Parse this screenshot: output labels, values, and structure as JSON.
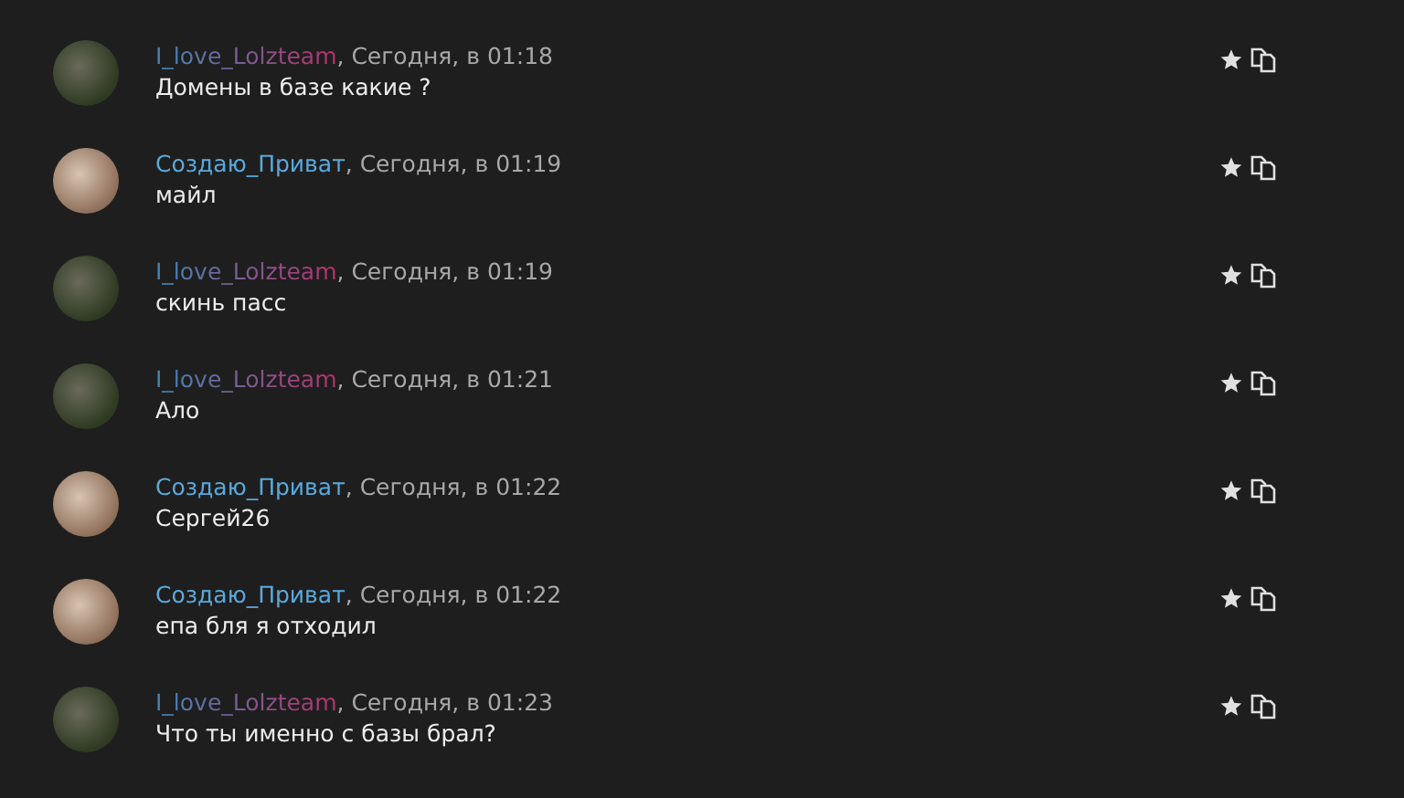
{
  "messages": [
    {
      "author": "I_love_Lolzteam",
      "gradient_name": true,
      "time": ", Сегодня, в 01:18",
      "text": "Домены в базе какие ?"
    },
    {
      "author": "Создаю_Приват",
      "gradient_name": false,
      "time": ", Сегодня, в 01:19",
      "text": "майл"
    },
    {
      "author": "I_love_Lolzteam",
      "gradient_name": true,
      "time": ", Сегодня, в 01:19",
      "text": "скинь пасс"
    },
    {
      "author": "I_love_Lolzteam",
      "gradient_name": true,
      "time": ", Сегодня, в 01:21",
      "text": "Ало"
    },
    {
      "author": "Создаю_Приват",
      "gradient_name": false,
      "time": ", Сегодня, в 01:22",
      "text": "Сергей26"
    },
    {
      "author": "Создаю_Приват",
      "gradient_name": false,
      "time": ", Сегодня, в 01:22",
      "text": "епа бля я отходил"
    },
    {
      "author": "I_love_Lolzteam",
      "gradient_name": true,
      "time": ", Сегодня, в 01:23",
      "text": "Что ты именно с базы брал?"
    }
  ]
}
